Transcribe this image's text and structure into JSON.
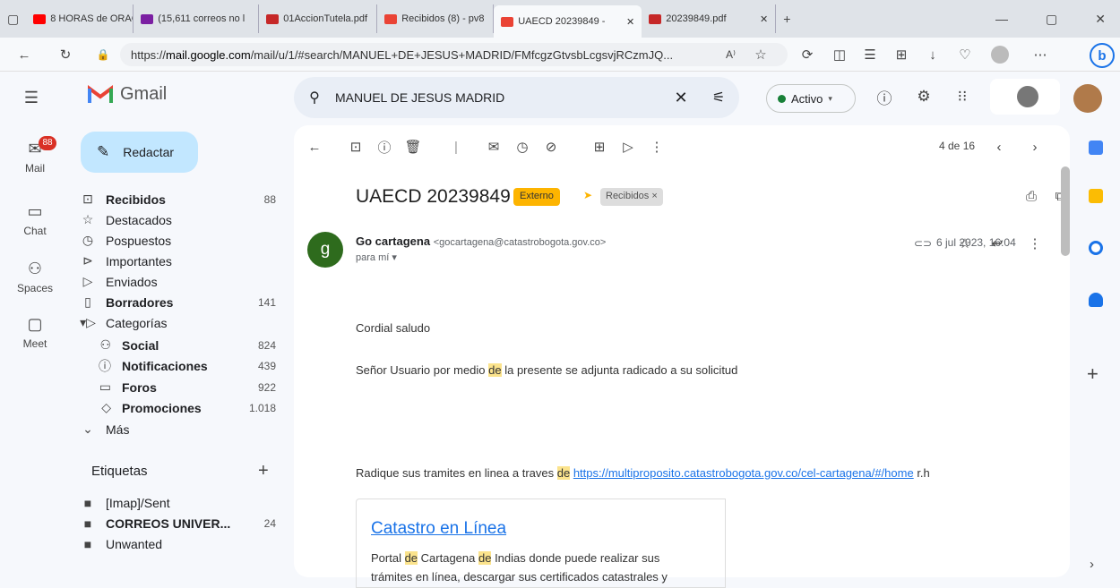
{
  "browser": {
    "tabs": [
      {
        "label": "8 HORAS de ORACL",
        "color": "#ff0000"
      },
      {
        "label": "(15,611 correos no l",
        "color": "#7b1fa2"
      },
      {
        "label": "01AccionTutela.pdf",
        "color": "#c62828"
      },
      {
        "label": "Recibidos (8) - pv8",
        "color": "#ea4335"
      },
      {
        "label": "UAECD 20239849 -",
        "color": "#ea4335"
      },
      {
        "label": "20239849.pdf",
        "color": "#c62828"
      }
    ],
    "url_prefix": "https://",
    "url_domain": "mail.google.com",
    "url_rest": "/mail/u/1/#search/MANUEL+DE+JESUS+MADRID/FMfcgzGtvsbLcgsvjRCzmJQ...",
    "url_extra": "A⁾"
  },
  "gmail": {
    "brand": "Gmail",
    "search_value": "MANUEL DE JESUS MADRID",
    "status": "Activo",
    "compose": "Redactar",
    "rail": {
      "mail": "Mail",
      "mail_badge": "88",
      "chat": "Chat",
      "spaces": "Spaces",
      "meet": "Meet"
    },
    "nav": [
      {
        "label": "Recibidos",
        "count": "88",
        "bold": true
      },
      {
        "label": "Destacados",
        "count": ""
      },
      {
        "label": "Pospuestos",
        "count": ""
      },
      {
        "label": "Importantes",
        "count": ""
      },
      {
        "label": "Enviados",
        "count": ""
      },
      {
        "label": "Borradores",
        "count": "141",
        "bold": true
      },
      {
        "label": "Categorías",
        "count": ""
      },
      {
        "label": "Social",
        "count": "824",
        "bold": true
      },
      {
        "label": "Notificaciones",
        "count": "439",
        "bold": true
      },
      {
        "label": "Foros",
        "count": "922",
        "bold": true
      },
      {
        "label": "Promociones",
        "count": "1.018",
        "bold": true
      },
      {
        "label": "Más",
        "count": ""
      }
    ],
    "labels_header": "Etiquetas",
    "labels": [
      {
        "label": "[Imap]/Sent",
        "count": ""
      },
      {
        "label": "CORREOS UNIVER...",
        "count": "24"
      },
      {
        "label": "Unwanted",
        "count": ""
      }
    ]
  },
  "message": {
    "pager": "4 de 16",
    "subject": "UAECD 20239849",
    "badge": "Externo",
    "chip": "Recibidos",
    "avatar": "g",
    "sender_name": "Go cartagena",
    "sender_email": "<gocartagena@catastrobogota.gov.co>",
    "to": "para mí",
    "date": "6 jul 2023, 16:04",
    "greeting": "Cordial saludo",
    "line1a": "Señor Usuario por medio ",
    "hl": "de",
    "line1b": " la presente se adjunta radicado a su solicitud",
    "line2a": "Radique sus tramites en linea a traves ",
    "line2link": "https://multiproposito.catastrobogota.gov.co/cel-cartagena/#/home",
    "line2b": " r.h",
    "card_title": "Catastro en Línea",
    "card_a": "Portal ",
    "card_b": " Cartagena ",
    "card_c": " Indias donde puede realizar sus",
    "card_line2": "trámites en línea, descargar sus certificados catastrales y"
  }
}
